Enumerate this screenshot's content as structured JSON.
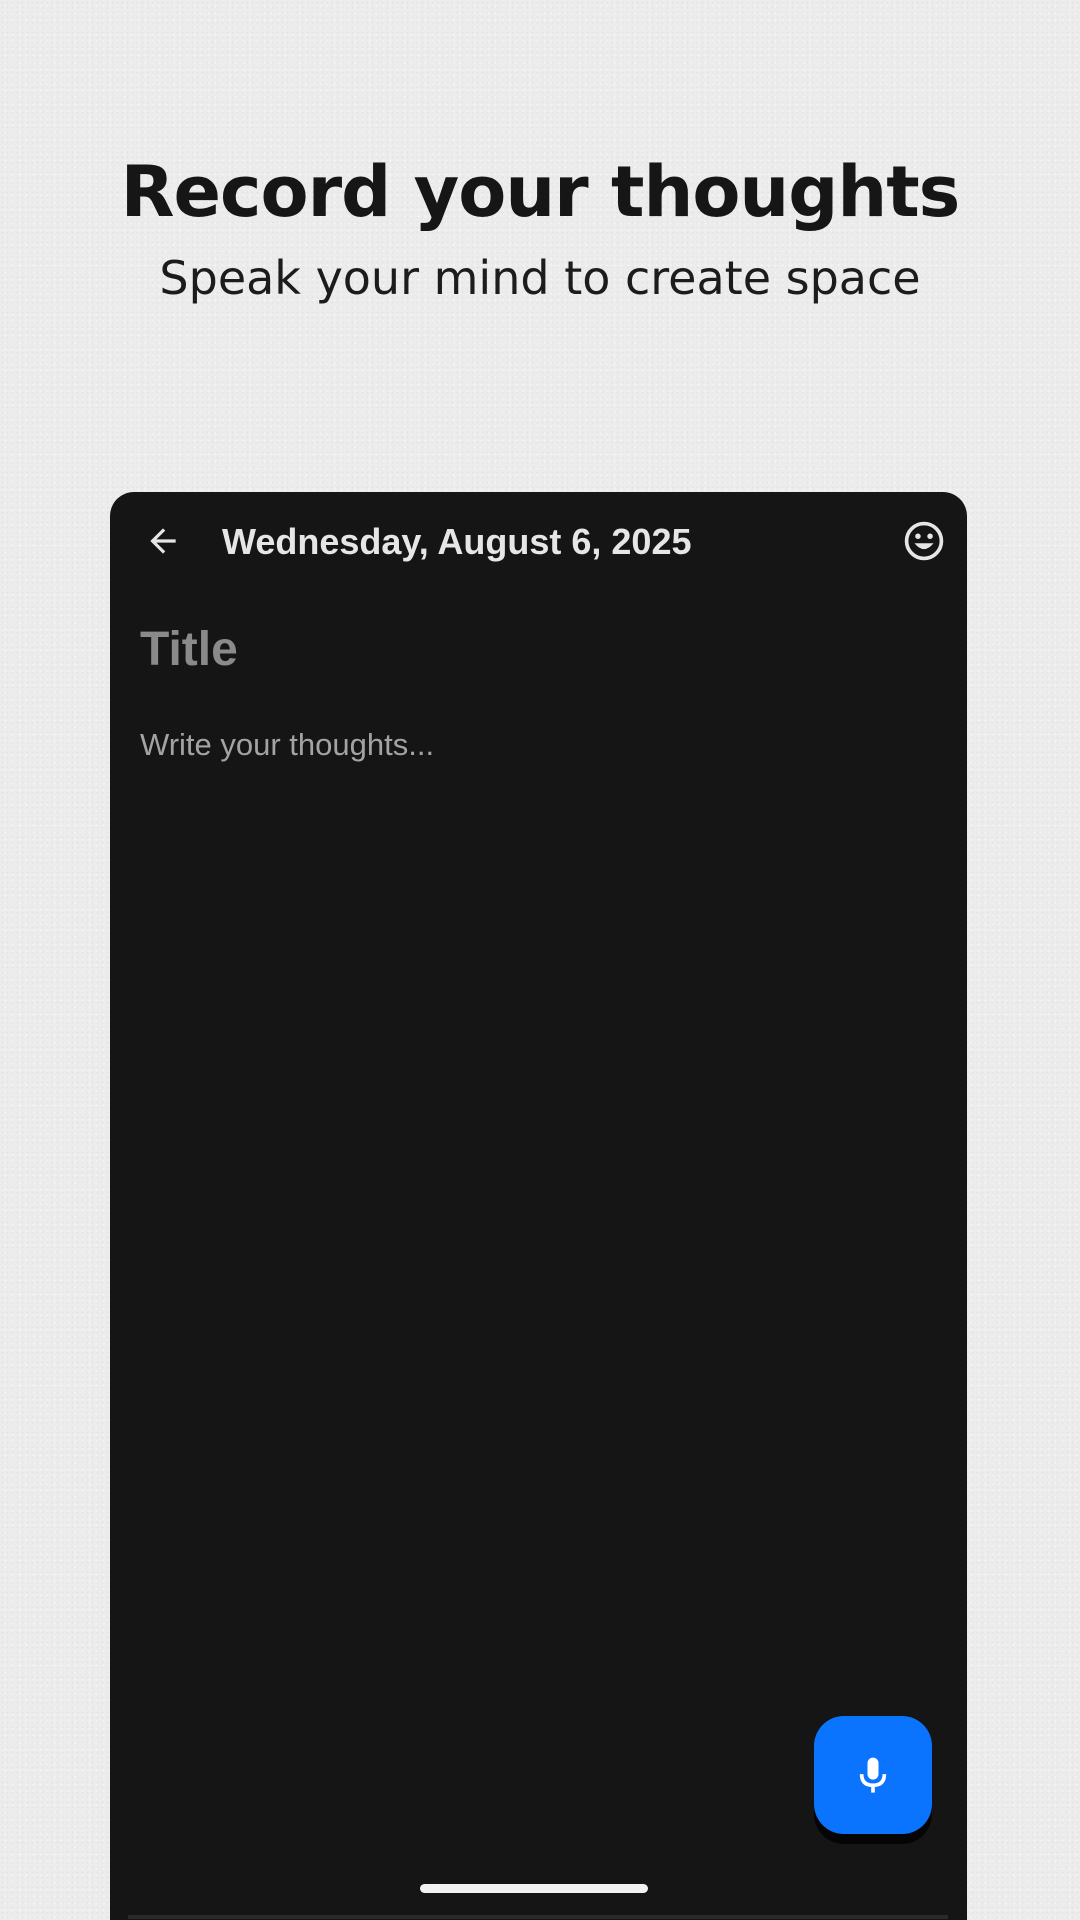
{
  "promo": {
    "headline": "Record your thoughts",
    "subheadline": "Speak your mind to create space"
  },
  "entry_screen": {
    "app_bar": {
      "back_icon": "arrow-left-icon",
      "date": "Wednesday, August 6, 2025",
      "mood_icon": "smiley-face-icon"
    },
    "title_placeholder": "Title",
    "body_placeholder": "Write your thoughts...",
    "fab": {
      "icon": "microphone-icon",
      "color": "#0a74ff"
    }
  },
  "colors": {
    "page_background": "#ececec",
    "screen_background": "#151515",
    "headline_text": "#161616",
    "app_bar_text": "#e6e6e6",
    "placeholder_title": "#8a8a8a",
    "placeholder_body": "#a3a3a3"
  }
}
